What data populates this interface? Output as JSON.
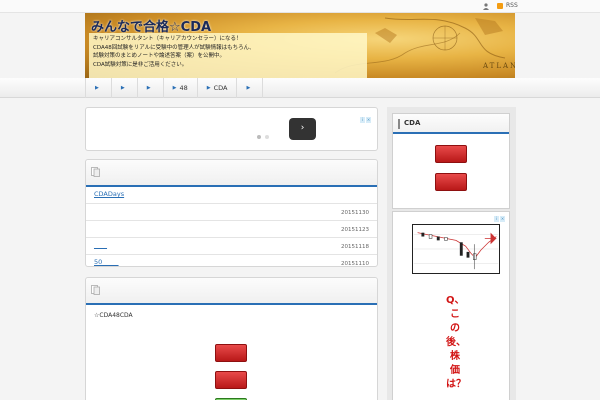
{
  "topbar": {
    "rss_label": "RSS",
    "icons": [
      "person-icon",
      "rss-icon"
    ]
  },
  "header": {
    "site_title": "みんなで合格☆CDA",
    "description_lines": [
      "キャリアコンサルタント（キャリアカウンセラー）になる！",
      "CDA48回試験をリアルに受験中の管理人が試験情報はもちろん、",
      "試験対策のまとめノートや論述答案（案）を公開中。",
      "CDA試験対策に是非ご活用ください。"
    ],
    "map_label": "ATLANTIC"
  },
  "nav": {
    "items": [
      {
        "label": ""
      },
      {
        "label": ""
      },
      {
        "label": ""
      },
      {
        "label": "48"
      },
      {
        "label": "CDA"
      },
      {
        "label": ""
      }
    ]
  },
  "posts": {
    "rows": [
      {
        "title": "CDADays",
        "date": ""
      },
      {
        "title": "",
        "date": "20151130"
      },
      {
        "title": "",
        "date": "20151123"
      },
      {
        "title": "____",
        "date": "20151118"
      },
      {
        "title": "50_____",
        "date": "20151110"
      }
    ]
  },
  "feature": {
    "text": "☆CDA48CDA"
  },
  "sidebar": {
    "widget_title": "CDA",
    "ad_copy": "Q、この後、株価は？"
  },
  "colors": {
    "accent": "#2a6fb5",
    "button_red": "#d02020",
    "button_green": "#5bb448"
  }
}
